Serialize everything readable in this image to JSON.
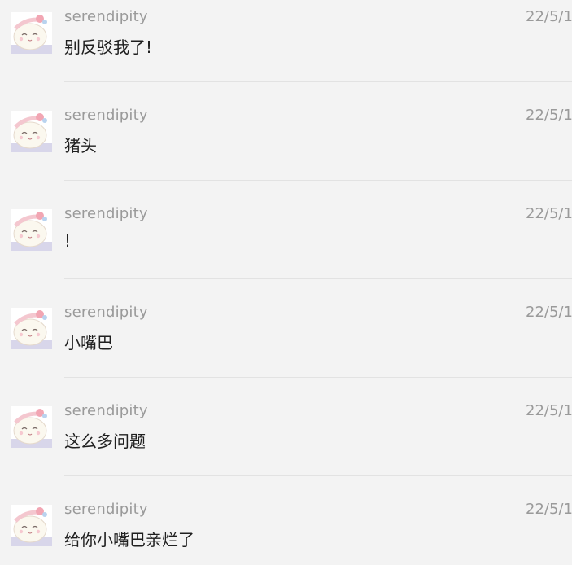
{
  "messages": [
    {
      "sender": "serendipity",
      "time": "22/5/1",
      "text": "别反驳我了!"
    },
    {
      "sender": "serendipity",
      "time": "22/5/1",
      "text": "猪头"
    },
    {
      "sender": "serendipity",
      "time": "22/5/1",
      "text": "!"
    },
    {
      "sender": "serendipity",
      "time": "22/5/1",
      "text": "小嘴巴"
    },
    {
      "sender": "serendipity",
      "time": "22/5/1",
      "text": "这么多问题"
    },
    {
      "sender": "serendipity",
      "time": "22/5/1",
      "text": "给你小嘴巴亲烂了"
    }
  ],
  "avatar_icon": "cartoon-avatar"
}
